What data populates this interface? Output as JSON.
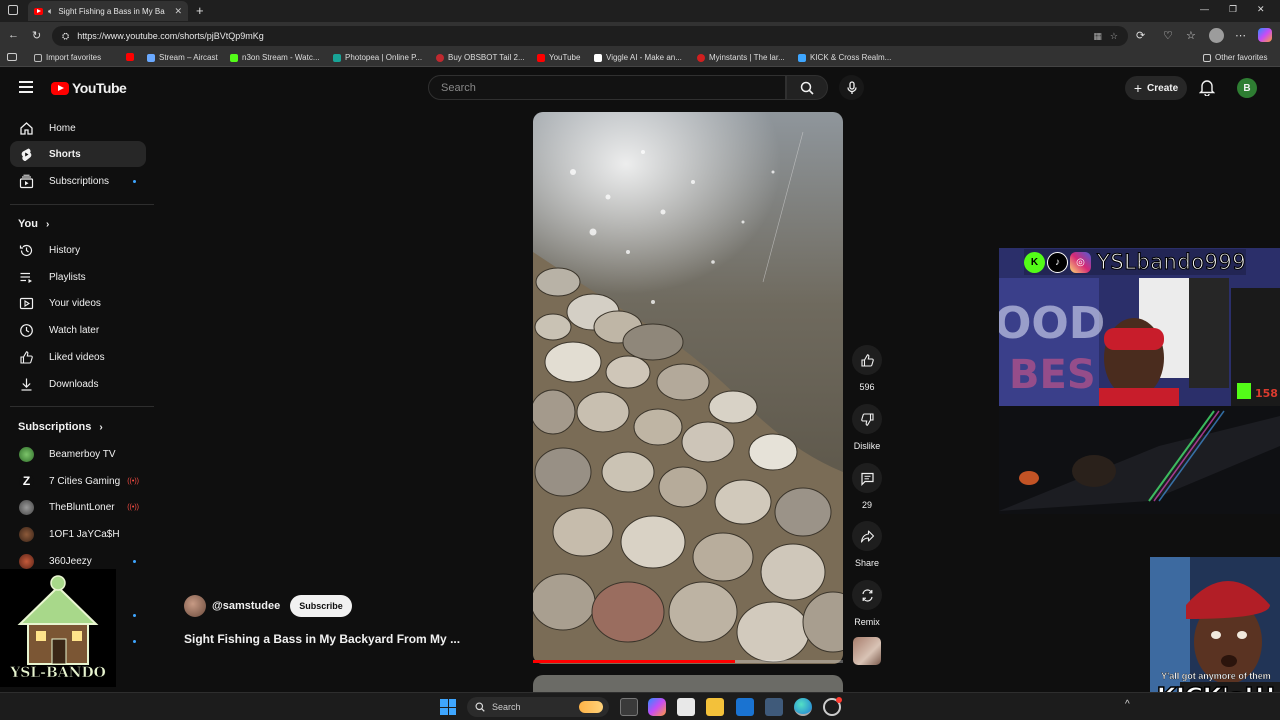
{
  "browser": {
    "tab_title": "Sight Fishing a Bass in My Ba",
    "url": "https://www.youtube.com/shorts/pjBVtQp9mKg",
    "bookmarks": [
      {
        "label": "Import favorites",
        "color": "#bbbbbb"
      },
      {
        "label": "",
        "color": "#ff0000"
      },
      {
        "label": "Stream – Aircast",
        "color": "#6aa9ff"
      },
      {
        "label": "n3on Stream - Watc...",
        "color": "#53fc18"
      },
      {
        "label": "Photopea | Online P...",
        "color": "#18a497"
      },
      {
        "label": "Buy OBSBOT Tail 2...",
        "color": "#c0292f"
      },
      {
        "label": "YouTube",
        "color": "#ff0000"
      },
      {
        "label": "Viggle AI - Make an...",
        "color": "#ffffff"
      },
      {
        "label": "Myinstants | The lar...",
        "color": "#d11f1f"
      },
      {
        "label": "KICK & Cross Realm...",
        "color": "#3ea6ff"
      }
    ],
    "other_favorites": "Other favorites"
  },
  "header": {
    "logo_text": "YouTube",
    "search_placeholder": "Search",
    "create_label": "Create",
    "avatar_letter": "B"
  },
  "sidebar": {
    "main": [
      {
        "label": "Home",
        "icon": "home-icon"
      },
      {
        "label": "Shorts",
        "icon": "shorts-icon",
        "active": true
      },
      {
        "label": "Subscriptions",
        "icon": "subscriptions-icon",
        "dot": true
      }
    ],
    "you_heading": "You",
    "you_items": [
      {
        "label": "History",
        "icon": "history-icon"
      },
      {
        "label": "Playlists",
        "icon": "playlists-icon"
      },
      {
        "label": "Your videos",
        "icon": "your-videos-icon"
      },
      {
        "label": "Watch later",
        "icon": "watch-later-icon"
      },
      {
        "label": "Liked videos",
        "icon": "liked-videos-icon"
      },
      {
        "label": "Downloads",
        "icon": "downloads-icon"
      }
    ],
    "subs_heading": "Subscriptions",
    "subscriptions": [
      {
        "label": "Beamerboy TV",
        "status": ""
      },
      {
        "label": "7 Cities Gaming",
        "status": "live"
      },
      {
        "label": "TheBluntLoner",
        "status": "live"
      },
      {
        "label": "1OF1 JaYCa$H",
        "status": ""
      },
      {
        "label": "360Jeezy",
        "status": "new"
      }
    ]
  },
  "short": {
    "channel": "@samstudee",
    "subscribe_label": "Subscribe",
    "title": "Sight Fishing a Bass in My Backyard From My ...",
    "progress": 0.65,
    "actions": {
      "like_count": "596",
      "dislike_label": "Dislike",
      "comment_count": "29",
      "share_label": "Share",
      "remix_label": "Remix"
    }
  },
  "overlay": {
    "handle": "YSLbando999",
    "logo_text": "YSL-BANDO",
    "meme_caption": "Y'all got anymore of them",
    "meme_big": "KICK's!!!"
  },
  "taskbar": {
    "search_label": "Search"
  },
  "colors": {
    "accent_red": "#ff0000",
    "kick_green": "#53fc18",
    "sub_dot_blue": "#3ea6ff"
  }
}
